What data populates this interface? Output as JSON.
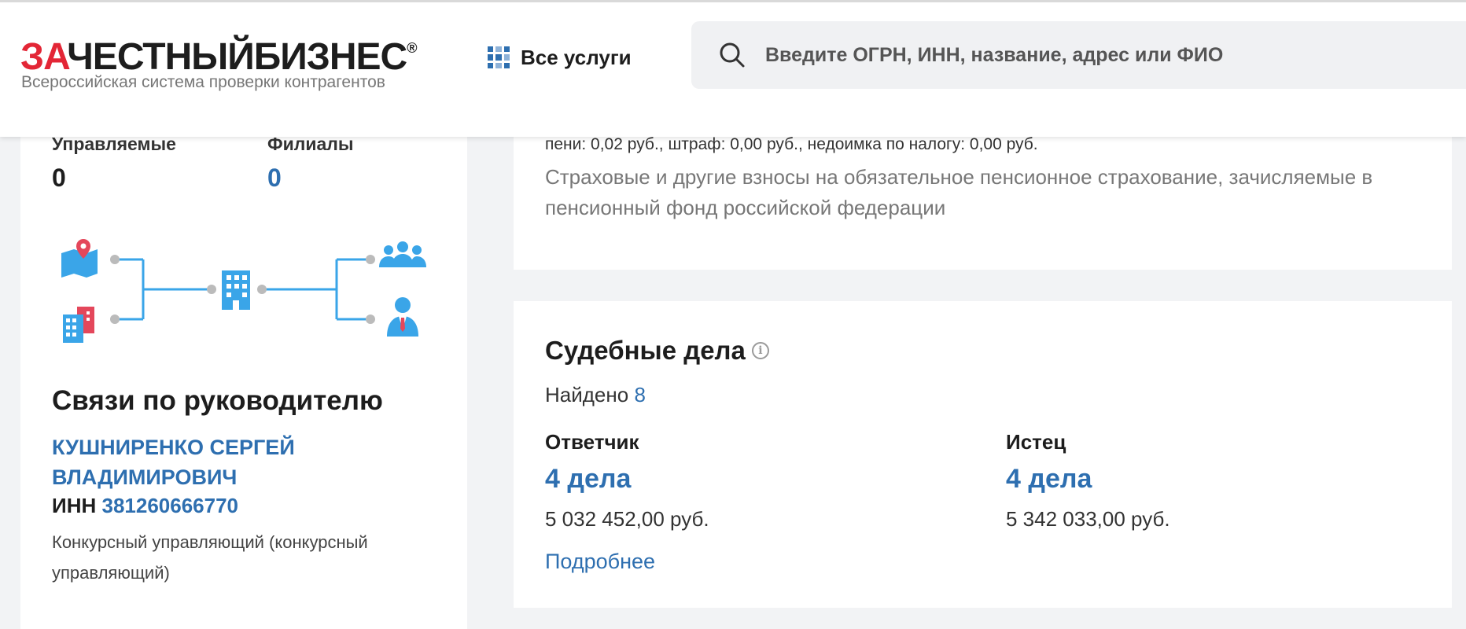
{
  "header": {
    "logo_part1": "ЗА",
    "logo_part2": "ЧЕСТНЫЙБИЗНЕС",
    "logo_reg": "®",
    "logo_tagline": "Всероссийская система проверки контрагентов",
    "services_label": "Все услуги",
    "search_placeholder": "Введите ОГРН, ИНН, название, адрес или ФИО"
  },
  "left_panel": {
    "managed_label": "Управляемые",
    "managed_value": "0",
    "branches_label": "Филиалы",
    "branches_value": "0",
    "section_title": "Связи по руководителю",
    "person_name": "КУШНИРЕНКО СЕРГЕЙ ВЛАДИМИРОВИЧ",
    "inn_label": "ИНН",
    "inn_value": "381260666770",
    "person_role": "Конкурсный управляющий (конкурсный управляющий)"
  },
  "tax_card": {
    "fine_line": "пени: 0,02 руб., штраф: 0,00 руб., недоимка по налогу: 0,00 руб.",
    "description": "Страховые и другие взносы на обязательное пенсионное страхование, зачисляемые в пенсионный фонд российской федерации"
  },
  "court_cases": {
    "title": "Судебные дела",
    "found_label": "Найдено",
    "found_count": "8",
    "defendant": {
      "label": "Ответчик",
      "count": "4 дела",
      "sum": "5 032 452,00 руб."
    },
    "plaintiff": {
      "label": "Истец",
      "count": "4 дела",
      "sum": "5 342 033,00 руб."
    },
    "more_link": "Подробнее"
  },
  "icons": {
    "services": "grid-icon",
    "search": "search-icon",
    "info": "info-icon",
    "diagram": [
      "map-pin-icon",
      "buildings-icon",
      "office-building-icon",
      "group-icon",
      "person-icon"
    ]
  },
  "colors": {
    "accent_blue": "#2e6fb0",
    "logo_red": "#e32636",
    "diagram_blue": "#3aa5e8"
  }
}
